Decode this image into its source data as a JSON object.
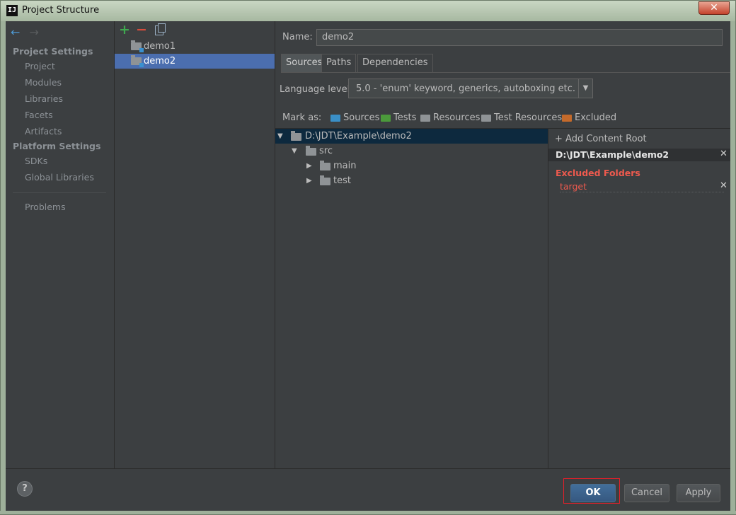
{
  "window": {
    "title": "Project Structure",
    "app_icon_text": "IJ",
    "close_glyph": "✕"
  },
  "nav": {
    "back_icon": "←",
    "forward_icon": "→",
    "sections": [
      {
        "title": "Project Settings",
        "items": [
          "Project",
          "Modules",
          "Libraries",
          "Facets",
          "Artifacts"
        ]
      },
      {
        "title": "Platform Settings",
        "items": [
          "SDKs",
          "Global Libraries"
        ]
      }
    ],
    "extra_items": [
      "Problems"
    ]
  },
  "modules": {
    "toolbar": {
      "add": "+",
      "remove": "−"
    },
    "items": [
      "demo1",
      "demo2"
    ],
    "selected": "demo2"
  },
  "content": {
    "name_label": "Name:",
    "name_value": "demo2",
    "tabs": [
      "Sources",
      "Paths",
      "Dependencies"
    ],
    "active_tab": "Sources",
    "language_level_label": "Language level:",
    "language_level_value": "5.0 - 'enum' keyword, generics, autoboxing etc.",
    "mark_as_label": "Mark as:",
    "mark_as": [
      {
        "label": "Sources",
        "color": "#3a8fc7"
      },
      {
        "label": "Tests",
        "color": "#4b9a3b"
      },
      {
        "label": "Resources",
        "color": "#8f9396"
      },
      {
        "label": "Test Resources",
        "color": "#8f9396"
      },
      {
        "label": "Excluded",
        "color": "#c46a2b"
      }
    ],
    "tree": [
      {
        "label": "D:\\JDT\\Example\\demo2",
        "expanded": true,
        "depth": 0,
        "selected": true
      },
      {
        "label": "src",
        "expanded": true,
        "depth": 1
      },
      {
        "label": "main",
        "expanded": false,
        "depth": 2
      },
      {
        "label": "test",
        "expanded": false,
        "depth": 2
      }
    ],
    "content_roots": {
      "add_label": "Add Content Root",
      "root_path": "D:\\JDT\\Example\\demo2",
      "excluded_title": "Excluded Folders",
      "excluded": [
        "target"
      ]
    }
  },
  "buttons": {
    "help": "?",
    "ok": "OK",
    "cancel": "Cancel",
    "apply": "Apply"
  },
  "colors": {
    "accent": "#4b6eaf",
    "excluded": "#ef5a4e",
    "highlight": "#e0202a"
  }
}
